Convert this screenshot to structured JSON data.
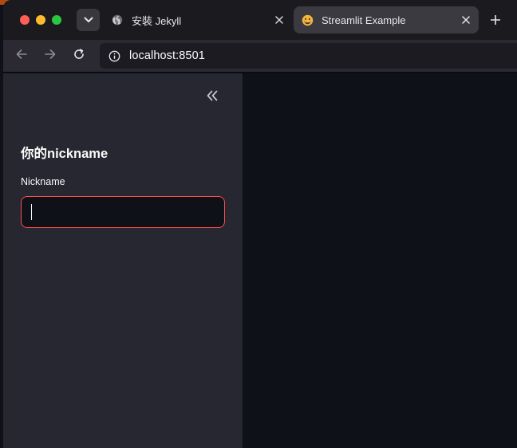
{
  "browser": {
    "tabs": [
      {
        "title": "安裝 Jekyll",
        "icon": "globe-icon",
        "active": false
      },
      {
        "title": "Streamlit Example",
        "icon": "grinning-face-icon",
        "active": true
      }
    ],
    "new_tab_icon": "plus-icon",
    "close_tab_icon": "close-icon",
    "address": "localhost:8501",
    "colors": {
      "titlebar": "#1b1b1f",
      "toolbar": "#2b2a33",
      "active_tab": "#3a3a40"
    }
  },
  "app": {
    "sidebar": {
      "title": "你的nickname",
      "collapse_icon": "double-chevron-left-icon",
      "nickname_field": {
        "label": "Nickname",
        "value": "",
        "placeholder": ""
      }
    },
    "colors": {
      "sidebar_bg": "#262730",
      "main_bg": "#0e1117",
      "input_focus_border": "#ff4b4b",
      "text": "#fafafa"
    }
  }
}
